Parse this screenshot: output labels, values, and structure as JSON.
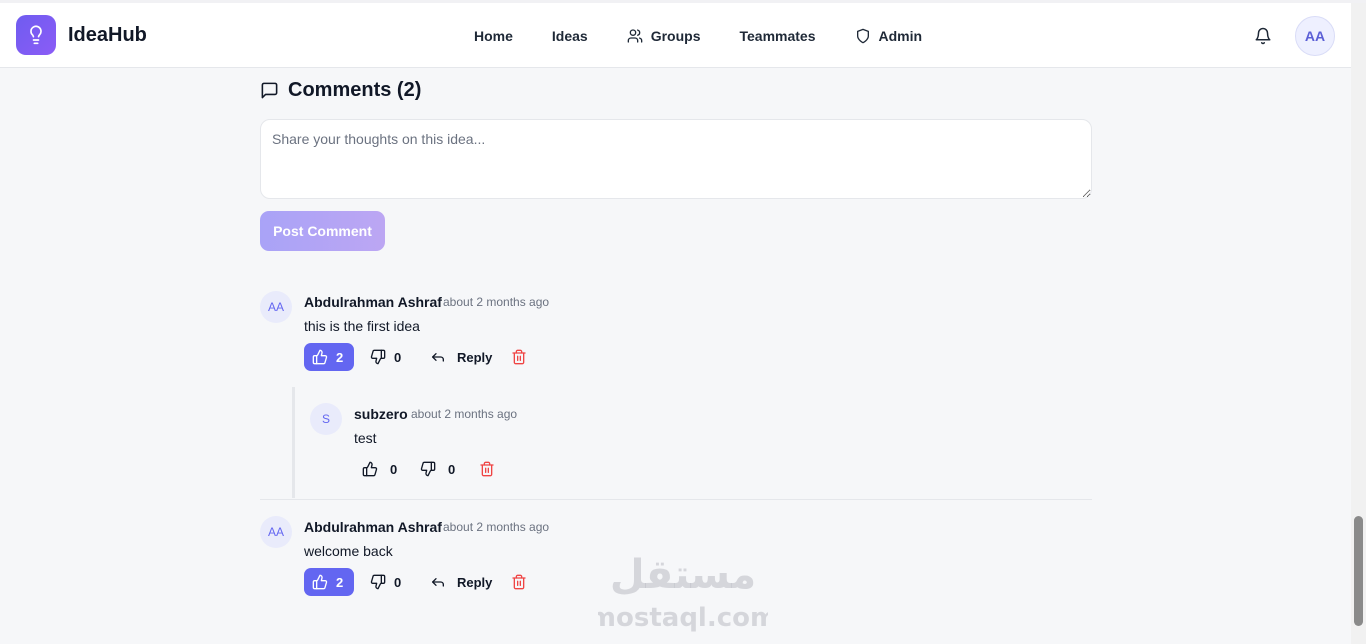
{
  "app": {
    "name": "IdeaHub"
  },
  "nav": {
    "home": "Home",
    "ideas": "Ideas",
    "groups": "Groups",
    "teammates": "Teammates",
    "admin": "Admin"
  },
  "user": {
    "initials": "AA"
  },
  "comments_section": {
    "title": "Comments (2)",
    "placeholder": "Share your thoughts on this idea...",
    "post_label": "Post Comment"
  },
  "comments": [
    {
      "initials": "AA",
      "author": "Abdulrahman Ashraf",
      "time": "about 2 months ago",
      "text": "this is the first idea",
      "likes": "2",
      "dislikes": "0",
      "reply_label": "Reply",
      "liked": true,
      "replies": [
        {
          "initials": "S",
          "author": "subzero",
          "time": "about 2 months ago",
          "text": "test",
          "likes": "0",
          "dislikes": "0"
        }
      ]
    },
    {
      "initials": "AA",
      "author": "Abdulrahman Ashraf",
      "time": "about 2 months ago",
      "text": "welcome back",
      "likes": "2",
      "dislikes": "0",
      "reply_label": "Reply",
      "liked": true
    }
  ],
  "watermark": {
    "arabic": "مستقل",
    "latin": "mostaql.com"
  },
  "colors": {
    "accent": "#6366f1",
    "delete": "#ef4444"
  },
  "icons": [
    "lightbulb-icon",
    "users-icon",
    "shield-icon",
    "bell-icon",
    "message-square-icon",
    "thumbs-up-icon",
    "thumbs-down-icon",
    "reply-icon",
    "trash-icon"
  ]
}
